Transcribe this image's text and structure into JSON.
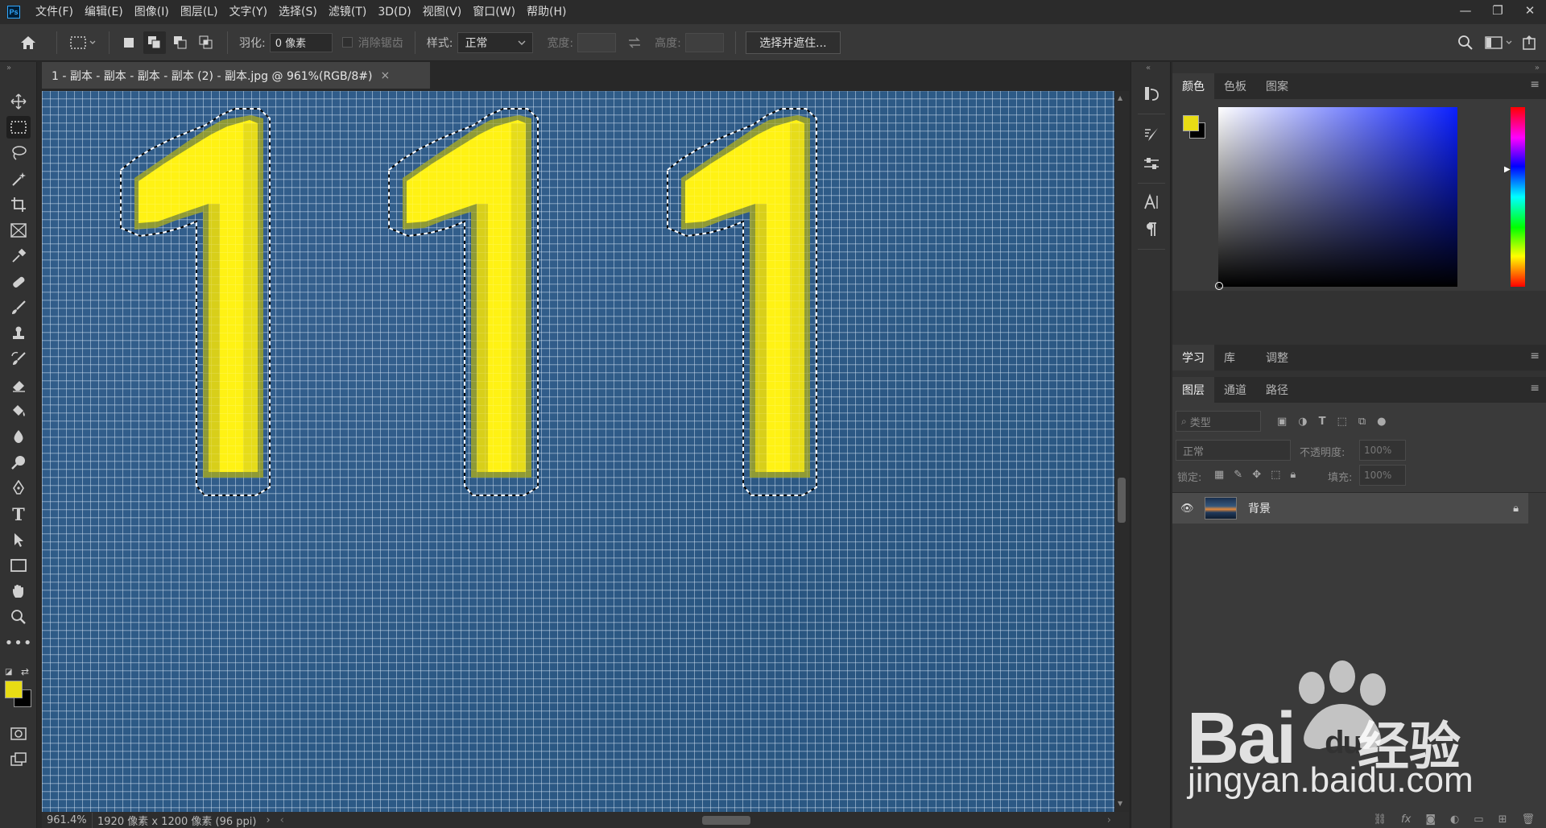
{
  "app": {
    "logo": "Ps"
  },
  "menu": [
    "文件(F)",
    "编辑(E)",
    "图像(I)",
    "图层(L)",
    "文字(Y)",
    "选择(S)",
    "滤镜(T)",
    "3D(D)",
    "视图(V)",
    "窗口(W)",
    "帮助(H)"
  ],
  "window_controls": {
    "minimize": "—",
    "restore": "❐",
    "close": "✕"
  },
  "options": {
    "feather_label": "羽化:",
    "feather_value": "0 像素",
    "antialias_label": "消除锯齿",
    "style_label": "样式:",
    "style_value": "正常",
    "width_label": "宽度:",
    "height_label": "高度:",
    "select_mask_button": "选择并遮住..."
  },
  "document": {
    "tab_title": "1 - 副本 - 副本 - 副本 - 副本 (2) - 副本.jpg @ 961%(RGB/8#)",
    "tab_close": "×",
    "zoom": "961.4%",
    "dimensions": "1920 像素 x 1200 像素 (96 ppi)"
  },
  "color_panel": {
    "tabs": [
      "颜色",
      "色板",
      "图案"
    ],
    "foreground": "#e8dc14",
    "background": "#000000"
  },
  "learn_panel": {
    "tabs": [
      "学习",
      "库",
      "调整"
    ]
  },
  "layers_panel": {
    "tabs": [
      "图层",
      "通道",
      "路径"
    ],
    "filter_placeholder": "类型",
    "blend_mode": "正常",
    "opacity_label": "不透明度:",
    "opacity_value": "100%",
    "lock_label": "锁定:",
    "fill_label": "填充:",
    "fill_value": "100%",
    "layers": [
      {
        "name": "背景",
        "visible": true,
        "locked": true
      }
    ]
  },
  "watermark": {
    "brand": "Bai",
    "brand_suffix": "du",
    "product": "经验",
    "url": "jingyan.baidu.com"
  },
  "colors": {
    "digit_yellow": "#fff214",
    "canvas_blue": "#2d5a86",
    "accent": "#e8dc14"
  }
}
